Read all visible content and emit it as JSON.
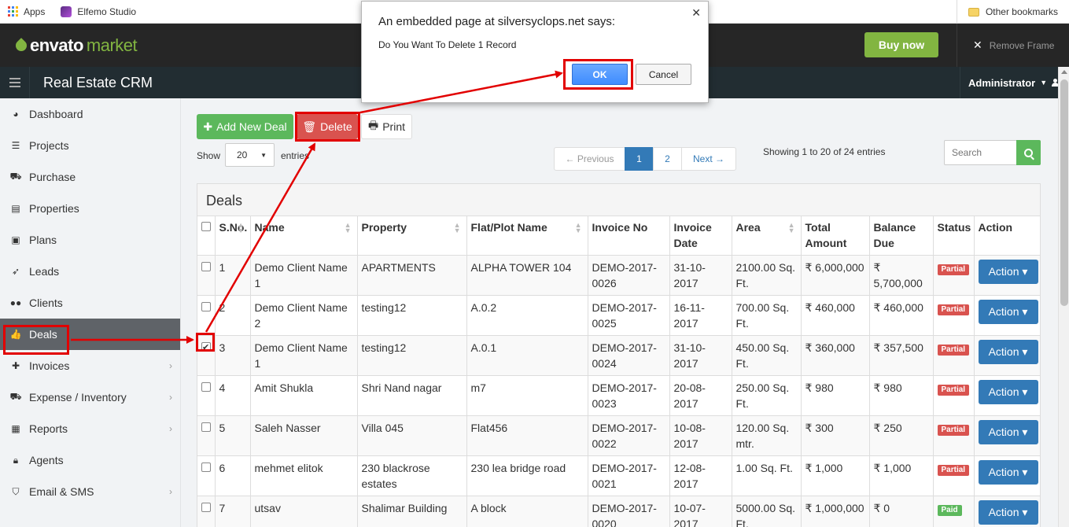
{
  "bookmarks": {
    "apps_label": "Apps",
    "elfemo_label": "Elfemo Studio",
    "other_label": "Other bookmarks"
  },
  "envato": {
    "logo_word1": "envato",
    "logo_word2": "market",
    "buy_now": "Buy now",
    "remove_frame": "Remove Frame"
  },
  "header": {
    "app_title": "Real Estate CRM",
    "user": "Administrator"
  },
  "sidebar": {
    "items": [
      {
        "label": "Dashboard",
        "icon": "tachometer-icon"
      },
      {
        "label": "Projects",
        "icon": "server-icon"
      },
      {
        "label": "Purchase",
        "icon": "cart-icon"
      },
      {
        "label": "Properties",
        "icon": "building-icon"
      },
      {
        "label": "Plans",
        "icon": "briefcase-icon"
      },
      {
        "label": "Leads",
        "icon": "rocket-icon"
      },
      {
        "label": "Clients",
        "icon": "users-icon"
      },
      {
        "label": "Deals",
        "icon": "thumbs-up-icon",
        "active": true
      },
      {
        "label": "Invoices",
        "icon": "pin-icon",
        "submenu": true
      },
      {
        "label": "Expense / Inventory",
        "icon": "cart-icon",
        "submenu": true
      },
      {
        "label": "Reports",
        "icon": "table-icon",
        "submenu": true
      },
      {
        "label": "Agents",
        "icon": "lock-icon"
      },
      {
        "label": "Email & SMS",
        "icon": "shield-icon",
        "submenu": true
      }
    ]
  },
  "toolbar": {
    "add_label": "Add New Deal",
    "delete_label": "Delete",
    "print_label": "Print"
  },
  "listing": {
    "show_label": "Show",
    "page_size": "20",
    "entries_label": "entries",
    "info": "Showing 1 to 20 of 24 entries",
    "search_placeholder": "Search",
    "pagination": {
      "prev": "← Previous",
      "page1": "1",
      "page2": "2",
      "next": "Next →"
    }
  },
  "panel": {
    "title": "Deals"
  },
  "table": {
    "columns": [
      "S.No.",
      "Name",
      "Property",
      "Flat/Plot Name",
      "Invoice No",
      "Invoice Date",
      "Area",
      "Total Amount",
      "Balance Due",
      "Status",
      "Action"
    ],
    "action_label": "Action",
    "rows": [
      {
        "sno": "1",
        "name": "Demo Client Name 1",
        "property": "APARTMENTS",
        "flat": "ALPHA TOWER 104",
        "invoice": "DEMO-2017-0026",
        "date": "31-10-2017",
        "area": "2100.00 Sq. Ft.",
        "total": "₹ 6,000,000",
        "balance": "₹ 5,700,000",
        "status": "Partial",
        "checked": false
      },
      {
        "sno": "2",
        "name": "Demo Client Name 2",
        "property": "testing12",
        "flat": "A.0.2",
        "invoice": "DEMO-2017-0025",
        "date": "16-11-2017",
        "area": "700.00 Sq. Ft.",
        "total": "₹ 460,000",
        "balance": "₹ 460,000",
        "status": "Partial",
        "checked": false
      },
      {
        "sno": "3",
        "name": "Demo Client Name 1",
        "property": "testing12",
        "flat": "A.0.1",
        "invoice": "DEMO-2017-0024",
        "date": "31-10-2017",
        "area": "450.00 Sq. Ft.",
        "total": "₹ 360,000",
        "balance": "₹ 357,500",
        "status": "Partial",
        "checked": true
      },
      {
        "sno": "4",
        "name": "Amit Shukla",
        "property": "Shri Nand nagar",
        "flat": "m7",
        "invoice": "DEMO-2017-0023",
        "date": "20-08-2017",
        "area": "250.00 Sq. Ft.",
        "total": "₹ 980",
        "balance": "₹ 980",
        "status": "Partial",
        "checked": false
      },
      {
        "sno": "5",
        "name": "Saleh Nasser",
        "property": "Villa 045",
        "flat": "Flat456",
        "invoice": "DEMO-2017-0022",
        "date": "10-08-2017",
        "area": "120.00 Sq. mtr.",
        "total": "₹ 300",
        "balance": "₹ 250",
        "status": "Partial",
        "checked": false
      },
      {
        "sno": "6",
        "name": "mehmet elitok",
        "property": "230 blackrose estates",
        "flat": "230 lea bridge road",
        "invoice": "DEMO-2017-0021",
        "date": "12-08-2017",
        "area": "1.00 Sq. Ft.",
        "total": "₹ 1,000",
        "balance": "₹ 1,000",
        "status": "Partial",
        "checked": false
      },
      {
        "sno": "7",
        "name": "utsav",
        "property": "Shalimar Building",
        "flat": "A block",
        "invoice": "DEMO-2017-0020",
        "date": "10-07-2017",
        "area": "5000.00 Sq. Ft.",
        "total": "₹ 1,000,000",
        "balance": "₹ 0",
        "status": "Paid",
        "checked": false
      }
    ]
  },
  "dialog": {
    "title": "An embedded page at silversyclops.net says:",
    "message": "Do You Want To Delete 1 Record",
    "ok": "OK",
    "cancel": "Cancel"
  },
  "colors": {
    "annotation_red": "#e20000",
    "success_green": "#5cb85c",
    "danger_red": "#d9534f",
    "primary_blue": "#337ab7",
    "envato_green": "#82b541"
  }
}
